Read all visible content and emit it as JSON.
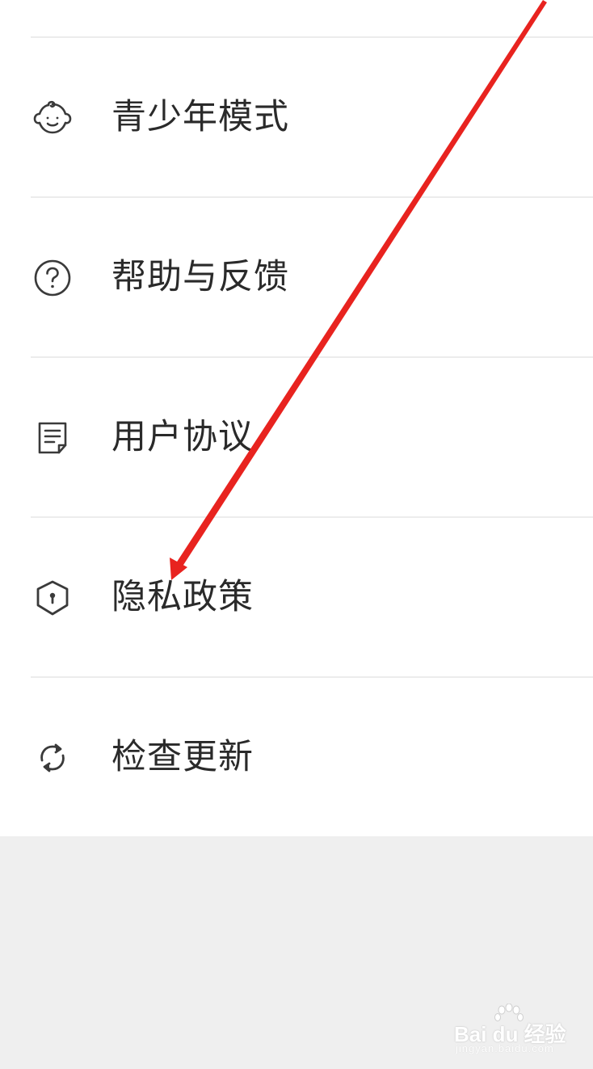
{
  "menu": {
    "items": [
      {
        "id": "teen-mode",
        "label": "青少年模式",
        "icon": "baby-face-icon"
      },
      {
        "id": "help-feedback",
        "label": "帮助与反馈",
        "icon": "help-circle-icon"
      },
      {
        "id": "user-agreement",
        "label": "用户协议",
        "icon": "document-icon"
      },
      {
        "id": "privacy-policy",
        "label": "隐私政策",
        "icon": "shield-lock-icon"
      },
      {
        "id": "check-update",
        "label": "检查更新",
        "icon": "refresh-icon"
      }
    ]
  },
  "colors": {
    "text": "#2a2a2a",
    "icon": "#3a3a3a",
    "divider": "#ececec",
    "background": "#ffffff",
    "bottom_area": "#efefef",
    "annotation_arrow": "#e8231f"
  },
  "watermark": {
    "brand": "Bai du 经验",
    "domain": "jingyan.baidu.com"
  }
}
